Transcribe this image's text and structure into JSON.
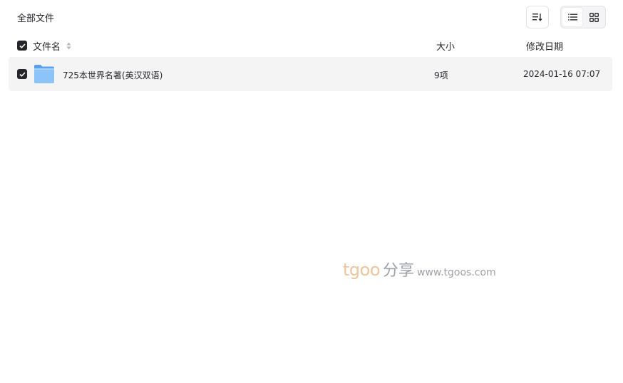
{
  "breadcrumb": {
    "current": "全部文件"
  },
  "toolbar": {
    "sort_icon": "sort-list-icon",
    "view_list_icon": "list-view-icon",
    "view_grid_icon": "grid-view-icon",
    "active_view": "list"
  },
  "table": {
    "headers": {
      "name": "文件名",
      "size": "大小",
      "modified": "修改日期"
    },
    "rows": [
      {
        "name": "725本世界名著(英汉双语)",
        "size": "9项",
        "modified": "2024-01-16 07:07",
        "type": "folder",
        "checked": true
      }
    ]
  },
  "watermark": {
    "logo": "tgoo",
    "share": "分享",
    "url": "www.tgoos.com"
  },
  "colors": {
    "text": "#25262b",
    "row_bg": "#f4f4f5",
    "folder_blue": "#7fb9f5",
    "watermark_orange": "#f2c49a"
  }
}
